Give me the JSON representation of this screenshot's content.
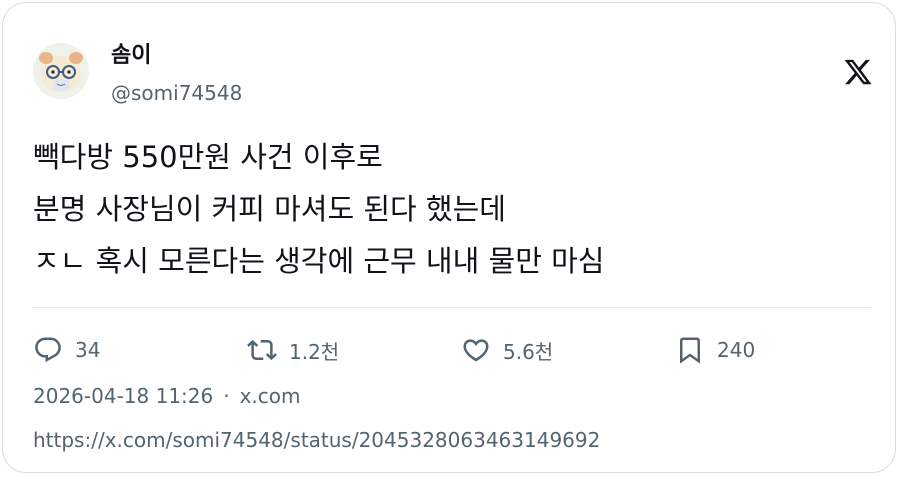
{
  "author": {
    "display_name": "솜이",
    "handle": "@somi74548",
    "avatar_icon": "avatar-character-icon"
  },
  "brand": {
    "logo_icon": "x-logo-icon"
  },
  "tweet": {
    "lines": [
      "빽다방 550만원 사건 이후로",
      "분명 사장님이 커피 마셔도 된다 했는데",
      "ㅈㄴ 혹시 모른다는 생각에 근무 내내 물만 마심"
    ]
  },
  "actions": {
    "reply": {
      "icon": "reply-icon",
      "count": "34"
    },
    "retweet": {
      "icon": "retweet-icon",
      "count": "1.2천"
    },
    "like": {
      "icon": "heart-icon",
      "count": "5.6천"
    },
    "bookmark": {
      "icon": "bookmark-icon",
      "count": "240"
    }
  },
  "meta": {
    "timestamp": "2026-04-18 11:26",
    "separator": "·",
    "source": "x.com"
  },
  "permalink": "https://x.com/somi74548/status/2045328063463149692",
  "colors": {
    "text_primary": "#0f1419",
    "text_secondary": "#536471",
    "divider": "#e7e9ea",
    "border": "#dcdcdc"
  }
}
